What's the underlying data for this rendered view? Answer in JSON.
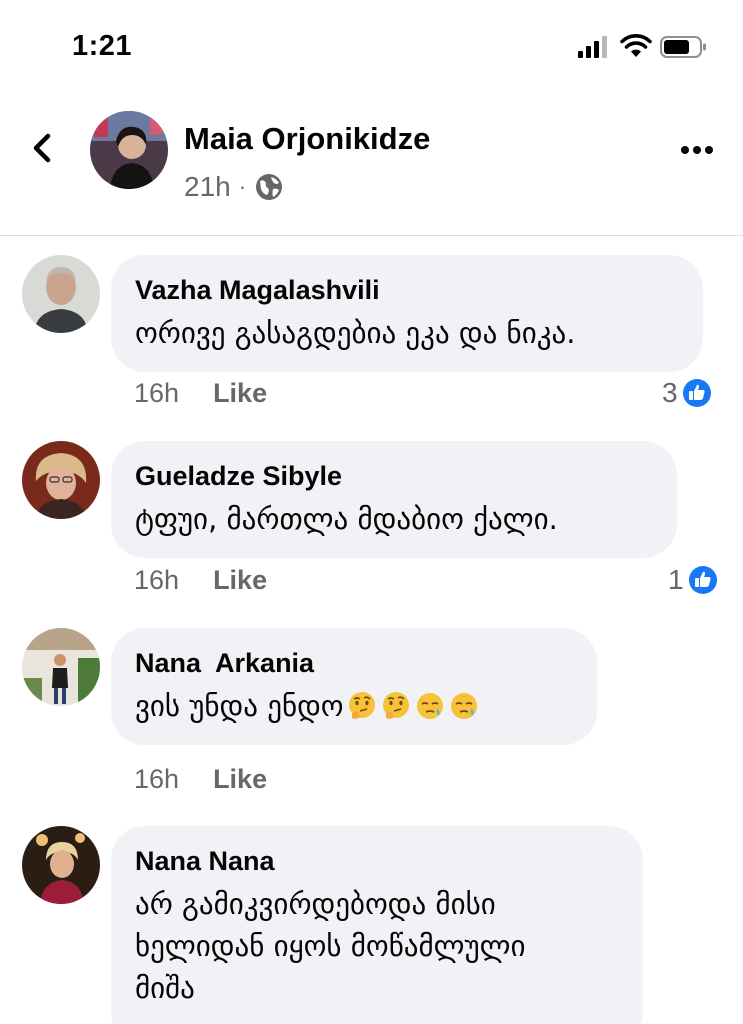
{
  "status_bar": {
    "time": "1:21"
  },
  "post": {
    "author": "Maia Orjonikidze",
    "time": "21h",
    "separator": "·"
  },
  "comments": [
    {
      "name": "Vazha Magalashvili",
      "text": "ორივე გასაგდებია ეკა და ნიკა.",
      "time": "16h",
      "like_label": "Like",
      "likes": "3"
    },
    {
      "name": "Gueladze Sibyle",
      "text": "ტფუი, მართლა მდაბიო ქალი.",
      "time": "16h",
      "like_label": "Like",
      "likes": "1"
    },
    {
      "name": "Nana  Arkania",
      "text": "ვის უნდა ენდო",
      "emojis": [
        "thinking-face",
        "thinking-face",
        "sleepy-face",
        "sleepy-face"
      ],
      "time": "16h",
      "like_label": "Like"
    },
    {
      "name": "Nana Nana",
      "text_lines": [
        "არ გამიკვირდებოდა მისი",
        "ხელიდან იყოს მოწამლული",
        "მიშა"
      ]
    }
  ],
  "colors": {
    "like_blue": "#1877f2",
    "bubble_bg": "#f0f2f5",
    "meta_gray": "#65676b"
  }
}
